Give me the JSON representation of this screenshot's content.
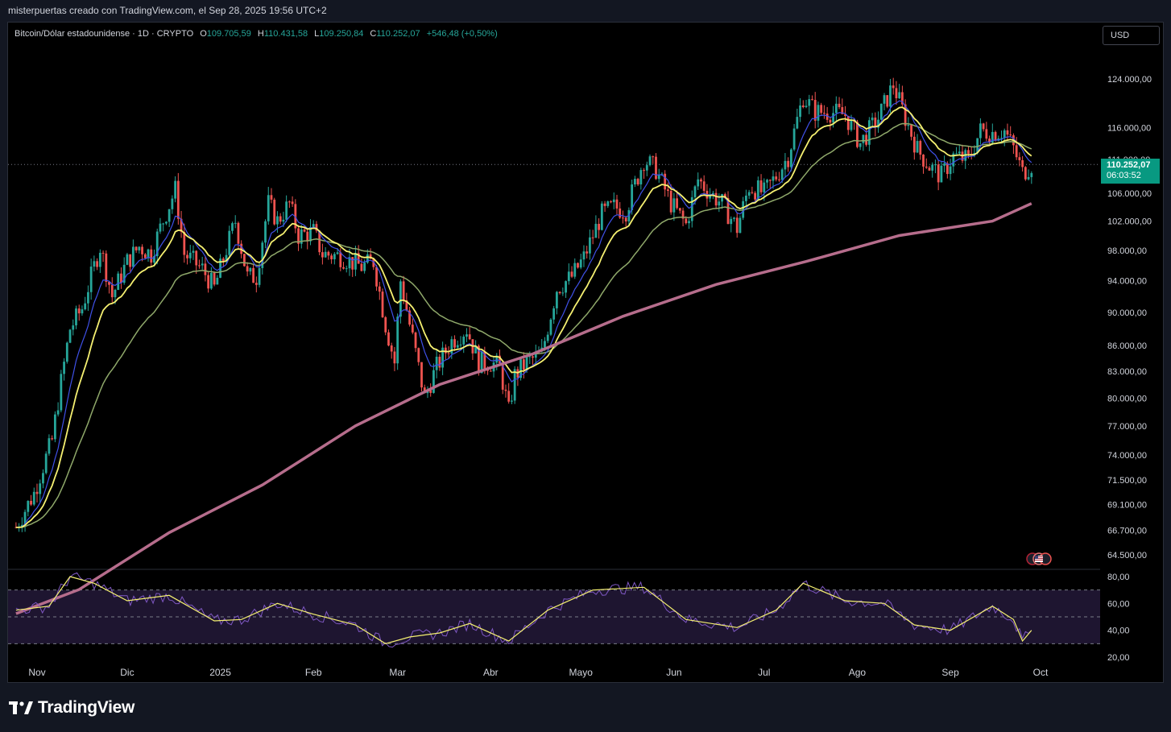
{
  "header": {
    "attribution": "misterpuertas creado con TradingView.com, el Sep 28, 2025 19:56 UTC+2"
  },
  "legend": {
    "symbol": "Bitcoin/Dólar estadounidense · 1D · CRYPTO",
    "o_label": "O",
    "o_value": "109.705,59",
    "h_label": "H",
    "h_value": "110.431,58",
    "l_label": "L",
    "l_value": "109.250,84",
    "c_label": "C",
    "c_value": "110.252,07",
    "change": "+546,48 (+0,50%)"
  },
  "currency_button": "USD",
  "price_tag": {
    "price": "110.252,07",
    "countdown": "06:03:52"
  },
  "footer": {
    "brand": "TradingView"
  },
  "colors": {
    "up": "#26a69a",
    "down": "#ef5350",
    "ema_fast": "#3f51e8",
    "ema_mid": "#f5f071",
    "ema_slow": "#8fa86a",
    "ema_long": "#b66d8c",
    "rsi": "#7e57c2",
    "rsi_ma": "#f5f071",
    "rsi_band": "#1e1530",
    "last_price": "#089981"
  },
  "chart_data": {
    "type": "candlestick",
    "price_axis_labels": [
      "124.000,00",
      "116.000,00",
      "111.000,00",
      "106.000,00",
      "102.000,00",
      "98.000,00",
      "94.000,00",
      "90.000,00",
      "86.000,00",
      "83.000,00",
      "80.000,00",
      "77.000,00",
      "74.000,00",
      "71.500,00",
      "69.100,00",
      "66.700,00",
      "64.500,00"
    ],
    "price_axis_values": [
      124000,
      116000,
      111000,
      106000,
      102000,
      98000,
      94000,
      90000,
      86000,
      83000,
      80000,
      77000,
      74000,
      71500,
      69100,
      66700,
      64500
    ],
    "rsi_axis_labels": [
      "80,00",
      "60,00",
      "40,00",
      "20,00"
    ],
    "rsi_axis_values": [
      80,
      60,
      40,
      20
    ],
    "rsi_bands": [
      70,
      50,
      30
    ],
    "time_axis_labels": [
      "Nov",
      "Dic",
      "2025",
      "Feb",
      "Mar",
      "Abr",
      "Mayo",
      "Jun",
      "Jul",
      "Ago",
      "Sep",
      "Oct"
    ],
    "time_axis_dates": [
      "2024-11-01",
      "2024-12-01",
      "2025-01-01",
      "2025-02-01",
      "2025-03-01",
      "2025-04-01",
      "2025-05-01",
      "2025-06-01",
      "2025-07-01",
      "2025-08-01",
      "2025-09-01",
      "2025-10-01"
    ],
    "log_scale": true,
    "close_series": [
      [
        "2024-10-25",
        67000
      ],
      [
        "2024-10-31",
        70200
      ],
      [
        "2024-11-06",
        75500
      ],
      [
        "2024-11-12",
        88000
      ],
      [
        "2024-11-16",
        90500
      ],
      [
        "2024-11-22",
        98500
      ],
      [
        "2024-11-26",
        92000
      ],
      [
        "2024-12-01",
        96500
      ],
      [
        "2024-12-05",
        98500
      ],
      [
        "2024-12-09",
        97500
      ],
      [
        "2024-12-12",
        101000
      ],
      [
        "2024-12-17",
        106500
      ],
      [
        "2024-12-20",
        97500
      ],
      [
        "2024-12-26",
        95500
      ],
      [
        "2024-12-30",
        93000
      ],
      [
        "2025-01-06",
        102000
      ],
      [
        "2025-01-10",
        94500
      ],
      [
        "2025-01-13",
        94500
      ],
      [
        "2025-01-17",
        104500
      ],
      [
        "2025-01-20",
        102000
      ],
      [
        "2025-01-24",
        104500
      ],
      [
        "2025-01-27",
        100000
      ],
      [
        "2025-02-01",
        100500
      ],
      [
        "2025-02-04",
        97500
      ],
      [
        "2025-02-10",
        97200
      ],
      [
        "2025-02-17",
        95800
      ],
      [
        "2025-02-21",
        96500
      ],
      [
        "2025-02-25",
        88500
      ],
      [
        "2025-02-28",
        84000
      ],
      [
        "2025-03-02",
        94000
      ],
      [
        "2025-03-05",
        88500
      ],
      [
        "2025-03-10",
        80000
      ],
      [
        "2025-03-14",
        83500
      ],
      [
        "2025-03-19",
        86500
      ],
      [
        "2025-03-24",
        88000
      ],
      [
        "2025-03-28",
        84000
      ],
      [
        "2025-04-01",
        84000
      ],
      [
        "2025-04-04",
        83500
      ],
      [
        "2025-04-07",
        78500
      ],
      [
        "2025-04-09",
        82500
      ],
      [
        "2025-04-13",
        84000
      ],
      [
        "2025-04-18",
        85000
      ],
      [
        "2025-04-23",
        93000
      ],
      [
        "2025-04-28",
        94500
      ],
      [
        "2025-05-02",
        97000
      ],
      [
        "2025-05-08",
        103000
      ],
      [
        "2025-05-12",
        104000
      ],
      [
        "2025-05-16",
        103500
      ],
      [
        "2025-05-22",
        111000
      ],
      [
        "2025-05-26",
        109500
      ],
      [
        "2025-05-31",
        104500
      ],
      [
        "2025-06-05",
        101500
      ],
      [
        "2025-06-09",
        108000
      ],
      [
        "2025-06-13",
        106000
      ],
      [
        "2025-06-17",
        104500
      ],
      [
        "2025-06-22",
        101000
      ],
      [
        "2025-06-26",
        107000
      ],
      [
        "2025-07-01",
        106000
      ],
      [
        "2025-07-05",
        108500
      ],
      [
        "2025-07-09",
        111500
      ],
      [
        "2025-07-14",
        121000
      ],
      [
        "2025-07-18",
        118500
      ],
      [
        "2025-07-23",
        118500
      ],
      [
        "2025-07-28",
        118000
      ],
      [
        "2025-08-02",
        113500
      ],
      [
        "2025-08-08",
        117500
      ],
      [
        "2025-08-13",
        123000
      ],
      [
        "2025-08-17",
        117500
      ],
      [
        "2025-08-21",
        112500
      ],
      [
        "2025-08-25",
        110000
      ],
      [
        "2025-08-29",
        108500
      ],
      [
        "2025-09-02",
        111500
      ],
      [
        "2025-09-07",
        111000
      ],
      [
        "2025-09-11",
        115500
      ],
      [
        "2025-09-15",
        115200
      ],
      [
        "2025-09-19",
        115500
      ],
      [
        "2025-09-22",
        112700
      ],
      [
        "2025-09-25",
        109000
      ],
      [
        "2025-09-28",
        110252
      ]
    ],
    "ema_long_series": [
      [
        "2024-10-25",
        59500
      ],
      [
        "2024-11-15",
        61500
      ],
      [
        "2024-12-15",
        66500
      ],
      [
        "2025-01-15",
        71000
      ],
      [
        "2025-02-15",
        77000
      ],
      [
        "2025-03-15",
        81500
      ],
      [
        "2025-04-15",
        85000
      ],
      [
        "2025-05-15",
        89500
      ],
      [
        "2025-06-15",
        93500
      ],
      [
        "2025-07-15",
        96500
      ],
      [
        "2025-08-15",
        100000
      ],
      [
        "2025-09-15",
        102000
      ],
      [
        "2025-09-28",
        104500
      ]
    ],
    "rsi_series": [
      [
        "2024-10-25",
        55
      ],
      [
        "2024-11-05",
        58
      ],
      [
        "2024-11-12",
        80
      ],
      [
        "2024-11-20",
        75
      ],
      [
        "2024-12-01",
        62
      ],
      [
        "2024-12-15",
        66
      ],
      [
        "2024-12-30",
        47
      ],
      [
        "2025-01-08",
        48
      ],
      [
        "2025-01-20",
        60
      ],
      [
        "2025-02-01",
        52
      ],
      [
        "2025-02-15",
        44
      ],
      [
        "2025-02-25",
        30
      ],
      [
        "2025-03-05",
        35
      ],
      [
        "2025-03-15",
        38
      ],
      [
        "2025-03-25",
        45
      ],
      [
        "2025-04-07",
        32
      ],
      [
        "2025-04-20",
        55
      ],
      [
        "2025-05-05",
        70
      ],
      [
        "2025-05-22",
        72
      ],
      [
        "2025-06-05",
        48
      ],
      [
        "2025-06-22",
        42
      ],
      [
        "2025-07-05",
        55
      ],
      [
        "2025-07-14",
        75
      ],
      [
        "2025-07-28",
        62
      ],
      [
        "2025-08-10",
        60
      ],
      [
        "2025-08-20",
        44
      ],
      [
        "2025-09-01",
        40
      ],
      [
        "2025-09-15",
        58
      ],
      [
        "2025-09-22",
        48
      ],
      [
        "2025-09-25",
        32
      ],
      [
        "2025-09-28",
        40
      ]
    ]
  }
}
